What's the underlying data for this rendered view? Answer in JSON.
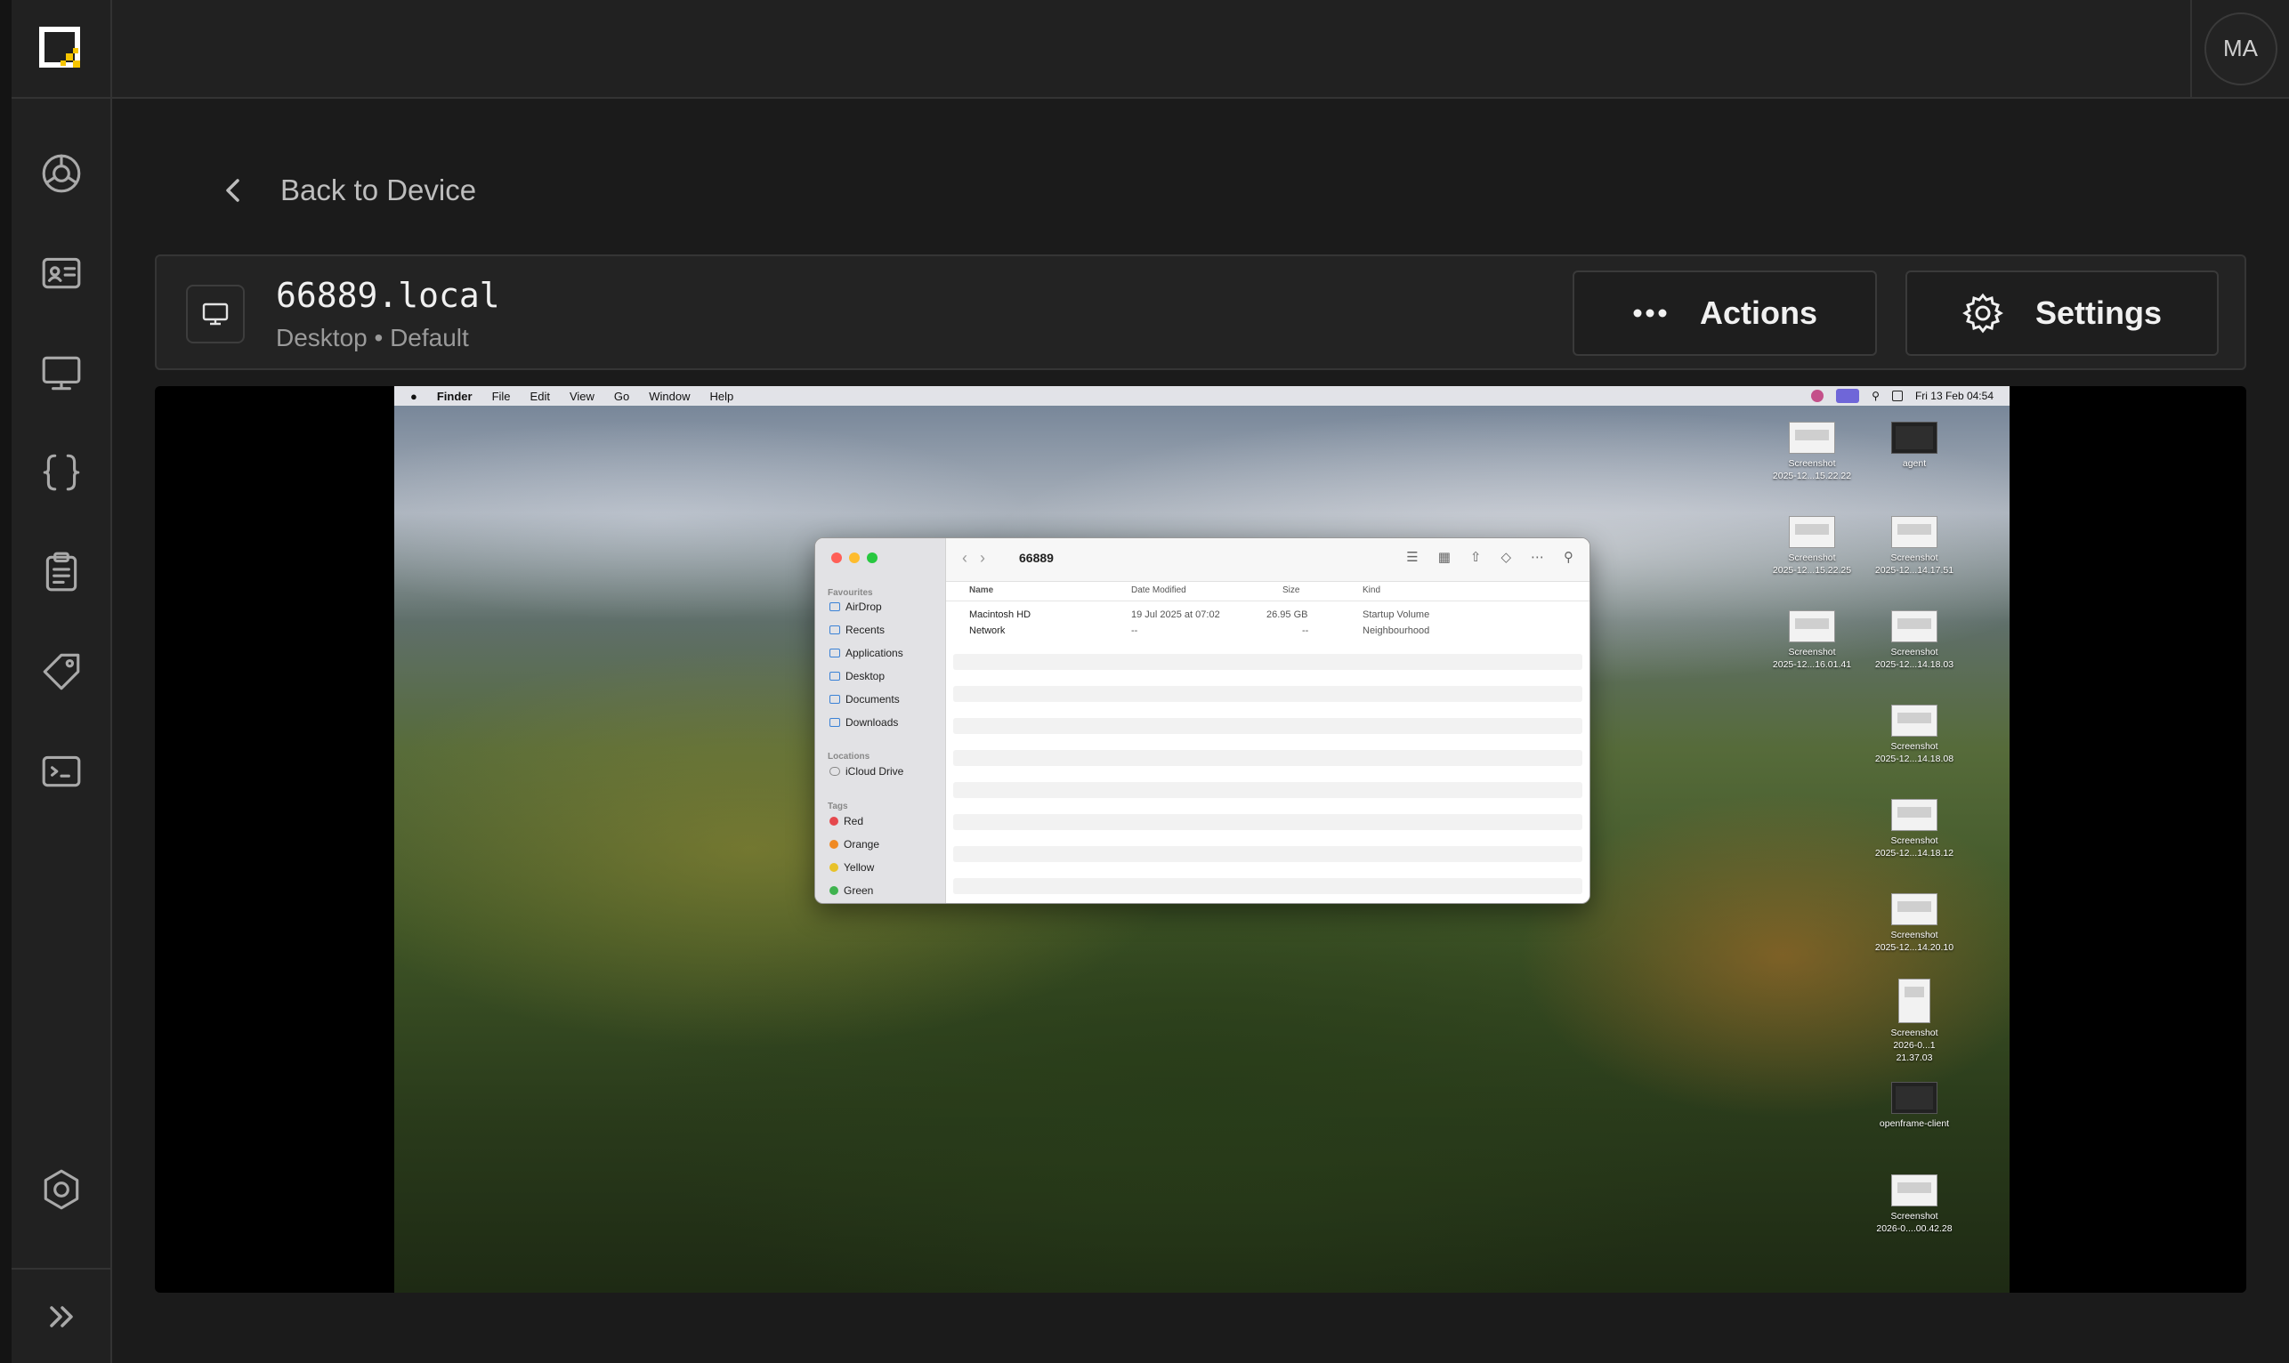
{
  "app": {
    "avatar_initials": "MA"
  },
  "sidebar": {
    "items": [
      {
        "name": "sidebar-item-dashboard",
        "icon": "radar-icon"
      },
      {
        "name": "sidebar-item-identities",
        "icon": "id-card-icon"
      },
      {
        "name": "sidebar-item-devices",
        "icon": "monitor-icon"
      },
      {
        "name": "sidebar-item-scripts",
        "icon": "braces-icon"
      },
      {
        "name": "sidebar-item-logs",
        "icon": "clipboard-icon"
      },
      {
        "name": "sidebar-item-tags",
        "icon": "tag-icon"
      },
      {
        "name": "sidebar-item-remote",
        "icon": "terminal-icon"
      }
    ],
    "settings_icon": "settings-icon",
    "expand_icon": "chevron-double-right-icon"
  },
  "nav": {
    "back_label": "Back to Device"
  },
  "device": {
    "name": "66889.local",
    "subtitle": "Desktop • Default",
    "actions_label": "Actions",
    "settings_label": "Settings"
  },
  "remote_screen": {
    "menubar": {
      "app": "Finder",
      "items": [
        "File",
        "Edit",
        "View",
        "Go",
        "Window",
        "Help"
      ],
      "clock": "Fri 13 Feb  04:54"
    },
    "finder": {
      "title": "66889",
      "sections": {
        "favourites": "Favourites",
        "locations": "Locations",
        "tags": "Tags"
      },
      "favourites": [
        "AirDrop",
        "Recents",
        "Applications",
        "Desktop",
        "Documents",
        "Downloads"
      ],
      "locations": [
        "iCloud Drive"
      ],
      "tags": [
        {
          "label": "Red",
          "color": "#e5484d"
        },
        {
          "label": "Orange",
          "color": "#f08a24"
        },
        {
          "label": "Yellow",
          "color": "#e8c22a"
        },
        {
          "label": "Green",
          "color": "#3fb34f"
        }
      ],
      "columns": [
        "Name",
        "Date Modified",
        "Size",
        "Kind"
      ],
      "rows": [
        {
          "name": "Macintosh HD",
          "date": "19 Jul 2025 at 07:02",
          "size": "26.95 GB",
          "kind": "Startup Volume"
        },
        {
          "name": "Network",
          "date": "--",
          "size": "--",
          "kind": "Neighbourhood"
        }
      ]
    },
    "desktop_icons": [
      {
        "line1": "Screenshot",
        "line2": "2025-12...15.22.22",
        "kind": "light"
      },
      {
        "line1": "agent",
        "line2": "",
        "kind": "dark"
      },
      {
        "line1": "Screenshot",
        "line2": "2025-12...15.22.25",
        "kind": "light"
      },
      {
        "line1": "Screenshot",
        "line2": "2025-12...14.17.51",
        "kind": "light"
      },
      {
        "line1": "Screenshot",
        "line2": "2025-12...16.01.41",
        "kind": "light"
      },
      {
        "line1": "Screenshot",
        "line2": "2025-12...14.18.03",
        "kind": "light"
      },
      {
        "line1": "Screenshot",
        "line2": "2025-12...14.18.08",
        "kind": "light"
      },
      {
        "line1": "Screenshot",
        "line2": "2025-12...14.18.12",
        "kind": "light"
      },
      {
        "line1": "Screenshot",
        "line2": "2025-12...14.20.10",
        "kind": "light"
      },
      {
        "line1": "Screenshot",
        "line2": "2026-0...1 21.37.03",
        "kind": "tall"
      },
      {
        "line1": "openframe-client",
        "line2": "",
        "kind": "dark"
      },
      {
        "line1": "Screenshot",
        "line2": "2026-0....00.42.28",
        "kind": "light"
      }
    ]
  }
}
